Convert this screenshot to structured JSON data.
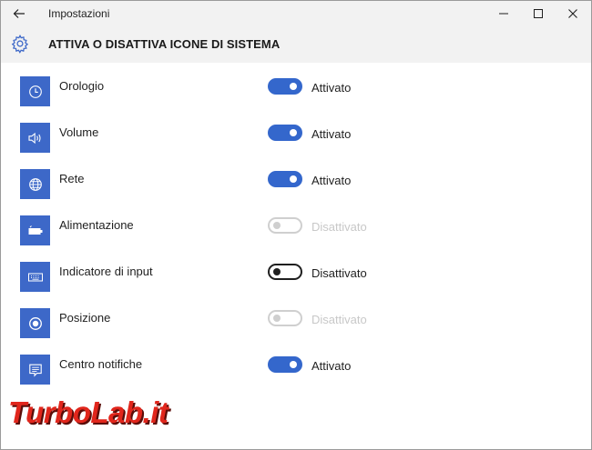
{
  "app": {
    "title": "Impostazioni"
  },
  "header": {
    "title": "ATTIVA O DISATTIVA ICONE DI SISTEMA"
  },
  "colors": {
    "accent": "#3467cc",
    "tile": "#3d68c8",
    "disabled": "#cfcfcf",
    "chrome": "#f2f2f2"
  },
  "items": [
    {
      "label": "Orologio",
      "icon": "clock-icon",
      "state": "on",
      "state_label": "Attivato"
    },
    {
      "label": "Volume",
      "icon": "speaker-icon",
      "state": "on",
      "state_label": "Attivato"
    },
    {
      "label": "Rete",
      "icon": "globe-icon",
      "state": "on",
      "state_label": "Attivato"
    },
    {
      "label": "Alimentazione",
      "icon": "battery-icon",
      "state": "disabled",
      "state_label": "Disattivato"
    },
    {
      "label": "Indicatore di input",
      "icon": "keyboard-icon",
      "state": "off",
      "state_label": "Disattivato"
    },
    {
      "label": "Posizione",
      "icon": "location-icon",
      "state": "disabled",
      "state_label": "Disattivato"
    },
    {
      "label": "Centro notifiche",
      "icon": "notification-icon",
      "state": "on",
      "state_label": "Attivato"
    }
  ],
  "watermark": {
    "text": "TurboLab.it"
  }
}
